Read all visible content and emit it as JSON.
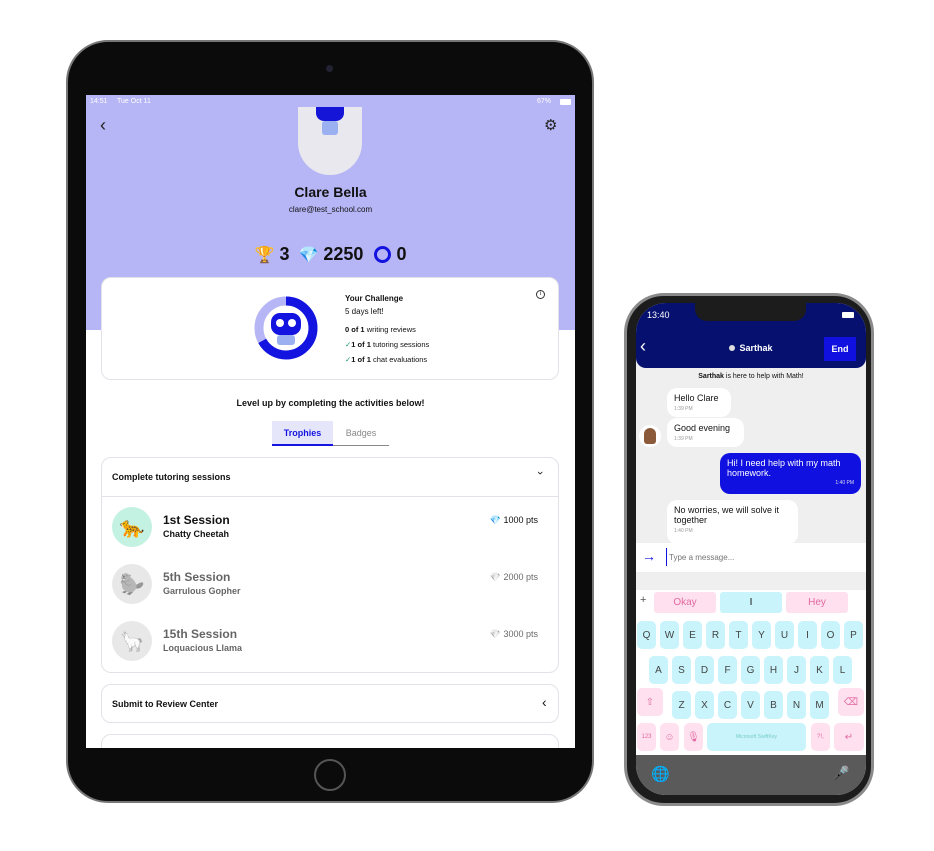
{
  "ipad": {
    "status": {
      "time": "14:51",
      "date": "Tue Oct 11",
      "battery": "67%"
    },
    "profile": {
      "name": "Clare Bella",
      "email": "clare@test_school.com"
    },
    "stats": {
      "trophies": "3",
      "gems": "2250",
      "rings": "0"
    },
    "challenge": {
      "title": "Your Challenge",
      "subtitle": "5 days left!",
      "progress_fraction": 0.67,
      "items": [
        {
          "bold": "0 of 1",
          "text": "writing reviews",
          "done": false
        },
        {
          "bold": "1 of 1",
          "text": "tutoring sessions",
          "done": true
        },
        {
          "bold": "1 of 1",
          "text": "chat evaluations",
          "done": true
        }
      ]
    },
    "level_up": "Level up by completing the activities below!",
    "tabs": [
      {
        "label": "Trophies",
        "active": true
      },
      {
        "label": "Badges",
        "active": false
      }
    ],
    "section": {
      "title": "Complete tutoring sessions",
      "rows": [
        {
          "title": "1st Session",
          "subtitle": "Chatty Cheetah",
          "pts": "1000 pts",
          "icon": "🐆",
          "done": true
        },
        {
          "title": "5th Session",
          "subtitle": "Garrulous Gopher",
          "pts": "2000 pts",
          "icon": "🦫",
          "done": false
        },
        {
          "title": "15th Session",
          "subtitle": "Loquacious Llama",
          "pts": "3000 pts",
          "icon": "🦙",
          "done": false
        }
      ]
    },
    "section2": {
      "title": "Submit to Review Center"
    },
    "colors": {
      "header": "#b6b5f5",
      "accent": "#1414e0"
    }
  },
  "iphone": {
    "status": {
      "time": "13:40"
    },
    "header": {
      "tutor": "Sarthak",
      "end_label": "End"
    },
    "intro": {
      "bold": "Sarthak",
      "text": " is here to help with Math!"
    },
    "messages": [
      {
        "text": "Hello Clare",
        "time": "1:39 PM",
        "from": "tutor"
      },
      {
        "text": "Good evening",
        "time": "1:39 PM",
        "from": "tutor"
      },
      {
        "text": "Hi! I need help with my math homework.",
        "time": "1:40 PM",
        "from": "me"
      },
      {
        "text": "No worries, we will solve it together",
        "time": "1:40 PM",
        "from": "tutor"
      }
    ],
    "input": {
      "placeholder": "Type a message..."
    },
    "keyboard": {
      "suggestions": [
        "Okay",
        "I",
        "Hey"
      ],
      "row1": [
        "Q",
        "W",
        "E",
        "R",
        "T",
        "Y",
        "U",
        "I",
        "O",
        "P"
      ],
      "row2": [
        "A",
        "S",
        "D",
        "F",
        "G",
        "H",
        "J",
        "K",
        "L"
      ],
      "row3": [
        "Z",
        "X",
        "C",
        "V",
        "B",
        "N",
        "M"
      ],
      "num": "123",
      "space": "Microsoft SwiftKey",
      "punct": "?!,"
    },
    "colors": {
      "header": "#06106e",
      "end": "#1010e0",
      "key": "#c9f4fb",
      "key_pink": "#ffe0ef"
    }
  }
}
